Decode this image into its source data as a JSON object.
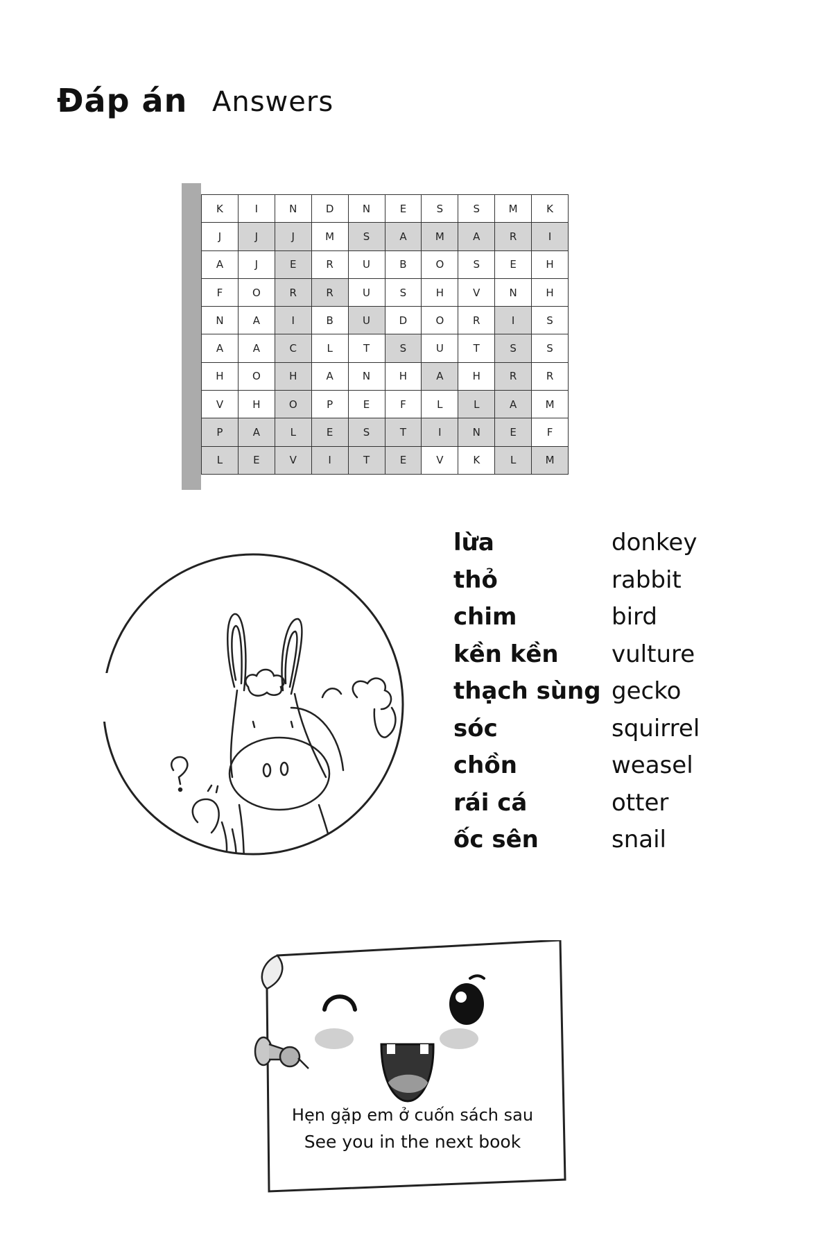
{
  "header": {
    "title_vi": "Đáp án",
    "title_en": "Answers"
  },
  "grid": {
    "rows": [
      [
        "K",
        "I",
        "N",
        "D",
        "N",
        "E",
        "S",
        "S",
        "M",
        "K"
      ],
      [
        "J",
        "J",
        "J",
        "M",
        "S",
        "A",
        "M",
        "A",
        "R",
        "I"
      ],
      [
        "A",
        "J",
        "E",
        "R",
        "U",
        "B",
        "O",
        "S",
        "E",
        "H"
      ],
      [
        "F",
        "O",
        "R",
        "R",
        "U",
        "S",
        "H",
        "V",
        "N",
        "H"
      ],
      [
        "N",
        "A",
        "I",
        "B",
        "U",
        "D",
        "O",
        "R",
        "I",
        "S"
      ],
      [
        "A",
        "A",
        "C",
        "L",
        "T",
        "S",
        "U",
        "T",
        "S",
        "S"
      ],
      [
        "H",
        "O",
        "H",
        "A",
        "N",
        "H",
        "A",
        "H",
        "R",
        "R"
      ],
      [
        "V",
        "H",
        "O",
        "P",
        "E",
        "F",
        "L",
        "L",
        "A",
        "M"
      ],
      [
        "P",
        "A",
        "L",
        "E",
        "S",
        "T",
        "I",
        "N",
        "E",
        "F"
      ],
      [
        "L",
        "E",
        "V",
        "I",
        "T",
        "E",
        "V",
        "K",
        "L",
        "M"
      ]
    ],
    "highlighted": [
      [
        0,
        0,
        0,
        0,
        0,
        0,
        0,
        0,
        0,
        0
      ],
      [
        0,
        1,
        1,
        0,
        1,
        1,
        1,
        1,
        1,
        1
      ],
      [
        0,
        0,
        1,
        0,
        0,
        0,
        0,
        0,
        0,
        0
      ],
      [
        0,
        0,
        1,
        1,
        0,
        0,
        0,
        0,
        0,
        0
      ],
      [
        0,
        0,
        1,
        0,
        1,
        0,
        0,
        0,
        1,
        0
      ],
      [
        0,
        0,
        1,
        0,
        0,
        1,
        0,
        0,
        1,
        0
      ],
      [
        0,
        0,
        1,
        0,
        0,
        0,
        1,
        0,
        1,
        0
      ],
      [
        0,
        0,
        1,
        0,
        0,
        0,
        0,
        1,
        1,
        0
      ],
      [
        1,
        1,
        1,
        1,
        1,
        1,
        1,
        1,
        1,
        0
      ],
      [
        1,
        1,
        1,
        1,
        1,
        1,
        0,
        0,
        1,
        1
      ]
    ]
  },
  "vocabulary": [
    {
      "vi": "lừa",
      "en": "donkey"
    },
    {
      "vi": "thỏ",
      "en": "rabbit"
    },
    {
      "vi": "chim",
      "en": "bird"
    },
    {
      "vi": "kền kền",
      "en": "vulture"
    },
    {
      "vi": "thạch sùng",
      "en": "gecko"
    },
    {
      "vi": "sóc",
      "en": "squirrel"
    },
    {
      "vi": "chồn",
      "en": "weasel"
    },
    {
      "vi": "rái cá",
      "en": "otter"
    },
    {
      "vi": "ốc sên",
      "en": "snail"
    }
  ],
  "illustration": {
    "icon": "donkey-illustration-icon"
  },
  "note": {
    "icon": "smiling-paper-icon",
    "text_vi": "Hẹn gặp em ở cuốn sách sau",
    "text_en": "See you in the next book",
    "colors": {
      "cheek": "#d0d0d0",
      "mouth": "#333333",
      "tongue": "#9a9a9a"
    }
  }
}
